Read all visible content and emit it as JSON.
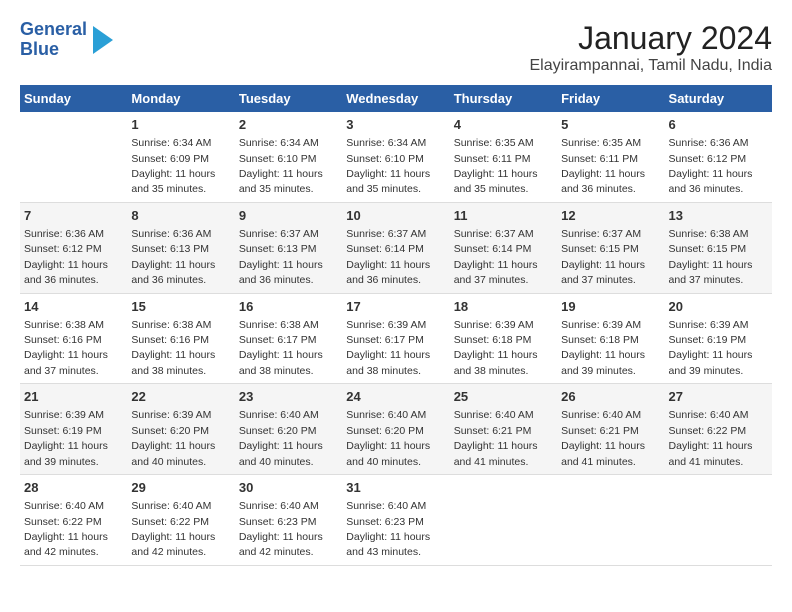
{
  "header": {
    "logo_line1": "General",
    "logo_line2": "Blue",
    "title": "January 2024",
    "subtitle": "Elayirampannai, Tamil Nadu, India"
  },
  "days_of_week": [
    "Sunday",
    "Monday",
    "Tuesday",
    "Wednesday",
    "Thursday",
    "Friday",
    "Saturday"
  ],
  "weeks": [
    [
      {
        "day": "",
        "sunrise": "",
        "sunset": "",
        "daylight": ""
      },
      {
        "day": "1",
        "sunrise": "Sunrise: 6:34 AM",
        "sunset": "Sunset: 6:09 PM",
        "daylight": "Daylight: 11 hours and 35 minutes."
      },
      {
        "day": "2",
        "sunrise": "Sunrise: 6:34 AM",
        "sunset": "Sunset: 6:10 PM",
        "daylight": "Daylight: 11 hours and 35 minutes."
      },
      {
        "day": "3",
        "sunrise": "Sunrise: 6:34 AM",
        "sunset": "Sunset: 6:10 PM",
        "daylight": "Daylight: 11 hours and 35 minutes."
      },
      {
        "day": "4",
        "sunrise": "Sunrise: 6:35 AM",
        "sunset": "Sunset: 6:11 PM",
        "daylight": "Daylight: 11 hours and 35 minutes."
      },
      {
        "day": "5",
        "sunrise": "Sunrise: 6:35 AM",
        "sunset": "Sunset: 6:11 PM",
        "daylight": "Daylight: 11 hours and 36 minutes."
      },
      {
        "day": "6",
        "sunrise": "Sunrise: 6:36 AM",
        "sunset": "Sunset: 6:12 PM",
        "daylight": "Daylight: 11 hours and 36 minutes."
      }
    ],
    [
      {
        "day": "7",
        "sunrise": "Sunrise: 6:36 AM",
        "sunset": "Sunset: 6:12 PM",
        "daylight": "Daylight: 11 hours and 36 minutes."
      },
      {
        "day": "8",
        "sunrise": "Sunrise: 6:36 AM",
        "sunset": "Sunset: 6:13 PM",
        "daylight": "Daylight: 11 hours and 36 minutes."
      },
      {
        "day": "9",
        "sunrise": "Sunrise: 6:37 AM",
        "sunset": "Sunset: 6:13 PM",
        "daylight": "Daylight: 11 hours and 36 minutes."
      },
      {
        "day": "10",
        "sunrise": "Sunrise: 6:37 AM",
        "sunset": "Sunset: 6:14 PM",
        "daylight": "Daylight: 11 hours and 36 minutes."
      },
      {
        "day": "11",
        "sunrise": "Sunrise: 6:37 AM",
        "sunset": "Sunset: 6:14 PM",
        "daylight": "Daylight: 11 hours and 37 minutes."
      },
      {
        "day": "12",
        "sunrise": "Sunrise: 6:37 AM",
        "sunset": "Sunset: 6:15 PM",
        "daylight": "Daylight: 11 hours and 37 minutes."
      },
      {
        "day": "13",
        "sunrise": "Sunrise: 6:38 AM",
        "sunset": "Sunset: 6:15 PM",
        "daylight": "Daylight: 11 hours and 37 minutes."
      }
    ],
    [
      {
        "day": "14",
        "sunrise": "Sunrise: 6:38 AM",
        "sunset": "Sunset: 6:16 PM",
        "daylight": "Daylight: 11 hours and 37 minutes."
      },
      {
        "day": "15",
        "sunrise": "Sunrise: 6:38 AM",
        "sunset": "Sunset: 6:16 PM",
        "daylight": "Daylight: 11 hours and 38 minutes."
      },
      {
        "day": "16",
        "sunrise": "Sunrise: 6:38 AM",
        "sunset": "Sunset: 6:17 PM",
        "daylight": "Daylight: 11 hours and 38 minutes."
      },
      {
        "day": "17",
        "sunrise": "Sunrise: 6:39 AM",
        "sunset": "Sunset: 6:17 PM",
        "daylight": "Daylight: 11 hours and 38 minutes."
      },
      {
        "day": "18",
        "sunrise": "Sunrise: 6:39 AM",
        "sunset": "Sunset: 6:18 PM",
        "daylight": "Daylight: 11 hours and 38 minutes."
      },
      {
        "day": "19",
        "sunrise": "Sunrise: 6:39 AM",
        "sunset": "Sunset: 6:18 PM",
        "daylight": "Daylight: 11 hours and 39 minutes."
      },
      {
        "day": "20",
        "sunrise": "Sunrise: 6:39 AM",
        "sunset": "Sunset: 6:19 PM",
        "daylight": "Daylight: 11 hours and 39 minutes."
      }
    ],
    [
      {
        "day": "21",
        "sunrise": "Sunrise: 6:39 AM",
        "sunset": "Sunset: 6:19 PM",
        "daylight": "Daylight: 11 hours and 39 minutes."
      },
      {
        "day": "22",
        "sunrise": "Sunrise: 6:39 AM",
        "sunset": "Sunset: 6:20 PM",
        "daylight": "Daylight: 11 hours and 40 minutes."
      },
      {
        "day": "23",
        "sunrise": "Sunrise: 6:40 AM",
        "sunset": "Sunset: 6:20 PM",
        "daylight": "Daylight: 11 hours and 40 minutes."
      },
      {
        "day": "24",
        "sunrise": "Sunrise: 6:40 AM",
        "sunset": "Sunset: 6:20 PM",
        "daylight": "Daylight: 11 hours and 40 minutes."
      },
      {
        "day": "25",
        "sunrise": "Sunrise: 6:40 AM",
        "sunset": "Sunset: 6:21 PM",
        "daylight": "Daylight: 11 hours and 41 minutes."
      },
      {
        "day": "26",
        "sunrise": "Sunrise: 6:40 AM",
        "sunset": "Sunset: 6:21 PM",
        "daylight": "Daylight: 11 hours and 41 minutes."
      },
      {
        "day": "27",
        "sunrise": "Sunrise: 6:40 AM",
        "sunset": "Sunset: 6:22 PM",
        "daylight": "Daylight: 11 hours and 41 minutes."
      }
    ],
    [
      {
        "day": "28",
        "sunrise": "Sunrise: 6:40 AM",
        "sunset": "Sunset: 6:22 PM",
        "daylight": "Daylight: 11 hours and 42 minutes."
      },
      {
        "day": "29",
        "sunrise": "Sunrise: 6:40 AM",
        "sunset": "Sunset: 6:22 PM",
        "daylight": "Daylight: 11 hours and 42 minutes."
      },
      {
        "day": "30",
        "sunrise": "Sunrise: 6:40 AM",
        "sunset": "Sunset: 6:23 PM",
        "daylight": "Daylight: 11 hours and 42 minutes."
      },
      {
        "day": "31",
        "sunrise": "Sunrise: 6:40 AM",
        "sunset": "Sunset: 6:23 PM",
        "daylight": "Daylight: 11 hours and 43 minutes."
      },
      {
        "day": "",
        "sunrise": "",
        "sunset": "",
        "daylight": ""
      },
      {
        "day": "",
        "sunrise": "",
        "sunset": "",
        "daylight": ""
      },
      {
        "day": "",
        "sunrise": "",
        "sunset": "",
        "daylight": ""
      }
    ]
  ]
}
